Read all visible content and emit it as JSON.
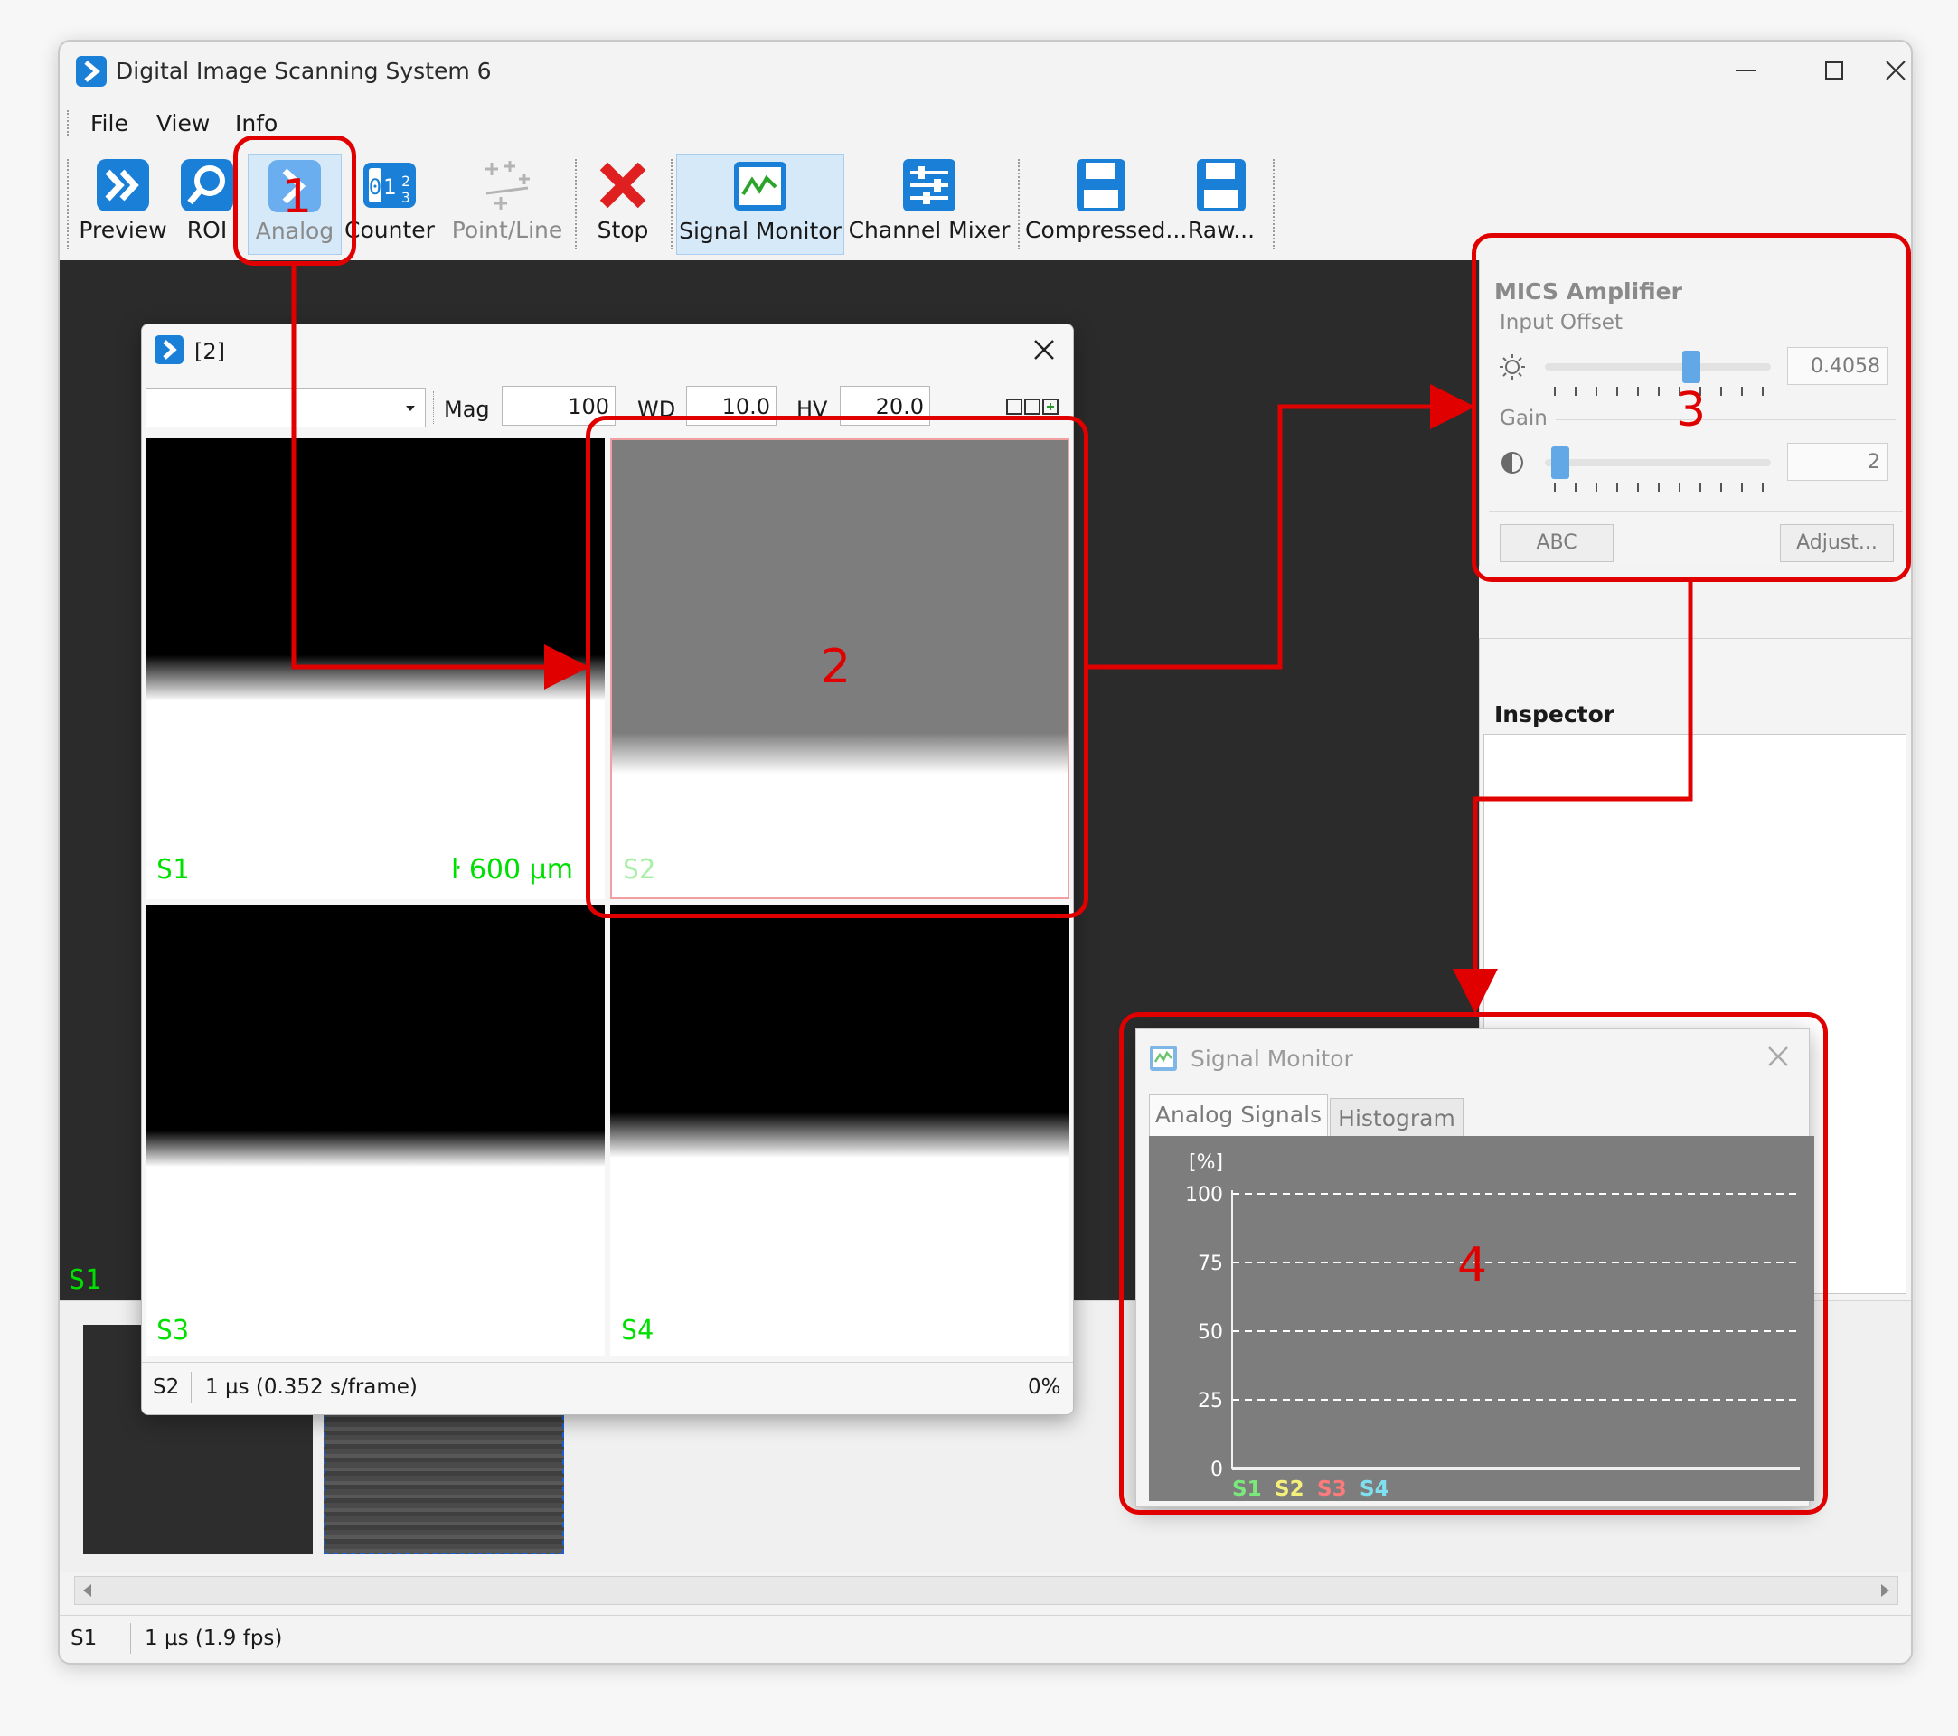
{
  "app": {
    "title": "Digital Image Scanning System 6"
  },
  "menu": {
    "file": "File",
    "view": "View",
    "info": "Info"
  },
  "toolbar": {
    "preview": "Preview",
    "roi": "ROI",
    "analog": "Analog",
    "counter": "Counter",
    "point_line": "Point/Line",
    "stop": "Stop",
    "signal_monitor": "Signal Monitor",
    "channel_mixer": "Channel Mixer",
    "compressed": "Compressed...",
    "raw": "Raw..."
  },
  "scan_window": {
    "title": "[2]",
    "mag_label": "Mag",
    "mag_value": "100",
    "wd_label": "WD",
    "wd_value": "10.0",
    "hv_label": "HV",
    "hv_value": "20.0",
    "quadrants": {
      "s1": "S1",
      "s2": "S2",
      "s3": "S3",
      "s4": "S4"
    },
    "scale_bar": "600 µm",
    "status_channel": "S2",
    "status_timing": "1 µs (0.352 s/frame)",
    "status_progress": "0%"
  },
  "workspace": {
    "channel_label": "S1"
  },
  "mics": {
    "title": "MICS Amplifier",
    "input_offset_label": "Input Offset",
    "input_offset_value": "0.4058",
    "input_offset_level": 0.66,
    "gain_label": "Gain",
    "gain_value": "2",
    "gain_level": 0.03,
    "abc_button": "ABC",
    "adjust_button": "Adjust..."
  },
  "inspector": {
    "title": "Inspector"
  },
  "signal_monitor": {
    "title": "Signal Monitor",
    "tabs": [
      "Analog Signals",
      "Histogram"
    ],
    "active_tab": "Analog Signals",
    "chart_data": {
      "type": "line",
      "title": "",
      "ylabel": "[%]",
      "ylim": [
        0,
        100
      ],
      "yticks": [
        "100",
        "75",
        "50",
        "25",
        "0"
      ],
      "grid": "dashed",
      "legend": [
        "S1",
        "S2",
        "S3",
        "S4"
      ],
      "legend_colors": [
        "#7be87b",
        "#f4f07a",
        "#ff7b7b",
        "#7fe0ef"
      ],
      "legend_position": "bottom-left",
      "series": []
    }
  },
  "statusbar": {
    "channel": "S1",
    "timing": "1 µs (1.9 fps)"
  },
  "annotations": {
    "n1": "1",
    "n2": "2",
    "n3": "3",
    "n4": "4"
  },
  "colors": {
    "annotation": "#e00000",
    "channel_label": "#00e000",
    "accent": "#1a7fd6"
  }
}
